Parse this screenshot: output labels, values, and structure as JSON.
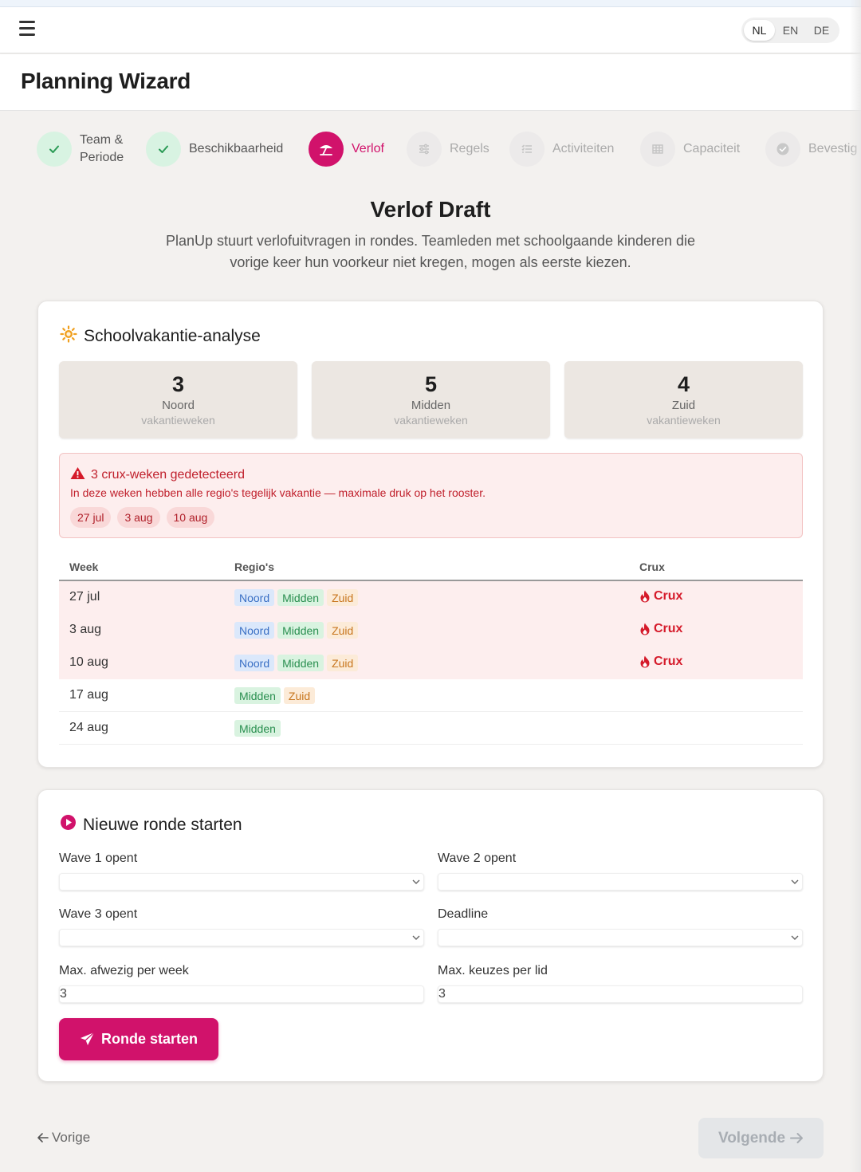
{
  "topbar": {
    "languages": [
      {
        "label": "NL",
        "active": true
      },
      {
        "label": "EN",
        "active": false
      },
      {
        "label": "DE",
        "active": false
      }
    ]
  },
  "header": {
    "title": "Planning Wizard"
  },
  "steps": [
    {
      "label_line1": "Team &",
      "label_line2": "Periode",
      "state": "done",
      "icon": "check-icon"
    },
    {
      "label": "Beschikbaarheid",
      "state": "done",
      "icon": "check-icon"
    },
    {
      "label": "Verlof",
      "state": "active",
      "icon": "umbrella-icon"
    },
    {
      "label": "Regels",
      "state": "todo",
      "icon": "sliders-icon"
    },
    {
      "label": "Activiteiten",
      "state": "todo",
      "icon": "list-icon"
    },
    {
      "label": "Capaciteit",
      "state": "todo",
      "icon": "grid-icon"
    },
    {
      "label": "Bevestig",
      "state": "todo",
      "icon": "check-circle-icon"
    }
  ],
  "intro": {
    "title": "Verlof Draft",
    "text": "PlanUp stuurt verlofuitvragen in rondes. Teamleden met schoolgaande kinderen die vorige keer hun voorkeur niet kregen, mogen als eerste kiezen."
  },
  "analysis": {
    "title": "Schoolvakantie-analyse",
    "stats": [
      {
        "value": "3",
        "region": "Noord",
        "sub": "vakantieweken"
      },
      {
        "value": "5",
        "region": "Midden",
        "sub": "vakantieweken"
      },
      {
        "value": "4",
        "region": "Zuid",
        "sub": "vakantieweken"
      }
    ],
    "alert": {
      "title": "3 crux-weken gedetecteerd",
      "text": "In deze weken hebben alle regio's tegelijk vakantie — maximale druk op het rooster.",
      "chips": [
        "27 jul",
        "3 aug",
        "10 aug"
      ]
    },
    "table": {
      "headers": {
        "week": "Week",
        "regions": "Regio's",
        "crux": "Crux"
      },
      "rows": [
        {
          "week": "27 jul",
          "regions": [
            "Noord",
            "Midden",
            "Zuid"
          ],
          "crux": "Crux"
        },
        {
          "week": "3 aug",
          "regions": [
            "Noord",
            "Midden",
            "Zuid"
          ],
          "crux": "Crux"
        },
        {
          "week": "10 aug",
          "regions": [
            "Noord",
            "Midden",
            "Zuid"
          ],
          "crux": "Crux"
        },
        {
          "week": "17 aug",
          "regions": [
            "Midden",
            "Zuid"
          ],
          "crux": ""
        },
        {
          "week": "24 aug",
          "regions": [
            "Midden"
          ],
          "crux": ""
        }
      ]
    }
  },
  "round": {
    "title": "Nieuwe ronde starten",
    "wave1_label": "Wave 1 opent",
    "wave2_label": "Wave 2 opent",
    "wave3_label": "Wave 3 opent",
    "deadline_label": "Deadline",
    "max_absent_label": "Max. afwezig per week",
    "max_absent_value": "3",
    "max_choices_label": "Max. keuzes per lid",
    "max_choices_value": "3",
    "start_label": "Ronde starten"
  },
  "footer": {
    "prev_label": "Vorige",
    "next_label": "Volgende"
  },
  "colors": {
    "accent": "#d1126b",
    "crux": "#d51a2a",
    "done": "#d8f3e2",
    "noord": "#3a6fc4",
    "midden": "#2a8f50",
    "zuid": "#c8761e"
  }
}
